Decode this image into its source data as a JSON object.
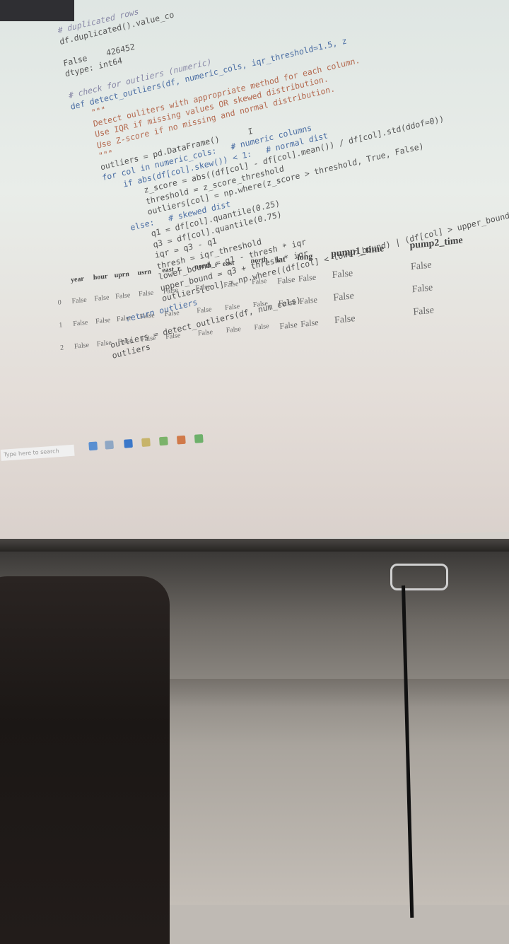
{
  "code_lines": [
    "# duplicated rows",
    "df.duplicated().value_co",
    "",
    "False    426452",
    "dtype: int64",
    "",
    "# check for outliers (numeric)",
    "def detect_outliers(df, numeric_cols, iqr_threshold=1.5, z",
    "    \"\"\"",
    "    Detect ouliters with appropriate method for each column.",
    "    Use IQR if missing values OR skewed distribution.",
    "    Use Z-score if no missing and normal distribution.",
    "    \"\"\"",
    "    outliers = pd.DataFrame()      I",
    "    for col in numeric_cols:   # numeric columns",
    "        if abs(df[col].skew()) < 1:   # normal dist",
    "            z_score = abs((df[col] - df[col].mean()) / df[col].std(ddof=0))",
    "            threshold = z_score_threshold",
    "            outliers[col] = np.where(z_score > threshold, True, False)",
    "        else:   # skewed dist",
    "            q1 = df[col].quantile(0.25)",
    "            q3 = df[col].quantile(0.75)",
    "            iqr = q3 - q1",
    "            thresh = iqr_threshold",
    "            lower_bound = q1 - thresh * iqr",
    "            upper_bound = q3 + thresh * iqr",
    "            outliers[col] = np.where((df[col] < lower_bound) | (df[col] > upper_bound),",
    "    return outliers",
    "",
    "outliers = detect_outliers(df, num_cols)",
    "outliers"
  ],
  "table": {
    "headers": [
      "year",
      "hour",
      "uprn",
      "usrn",
      "east_r",
      "north_r",
      "east",
      "north",
      "lat",
      "long",
      "pump1_time",
      "pump2_time"
    ],
    "rows": [
      {
        "index": "0",
        "values": [
          "False",
          "False",
          "False",
          "False",
          "False",
          "False",
          "False",
          "False",
          "False",
          "False",
          "False",
          "False"
        ]
      },
      {
        "index": "1",
        "values": [
          "False",
          "False",
          "False",
          "False",
          "False",
          "False",
          "False",
          "False",
          "False",
          "False",
          "False",
          "False"
        ]
      },
      {
        "index": "2",
        "values": [
          "False",
          "False",
          "False",
          "False",
          "False",
          "False",
          "False",
          "False",
          "False",
          "False",
          "False",
          "False"
        ]
      }
    ]
  },
  "taskbar": {
    "search_placeholder": "Type here to search"
  }
}
